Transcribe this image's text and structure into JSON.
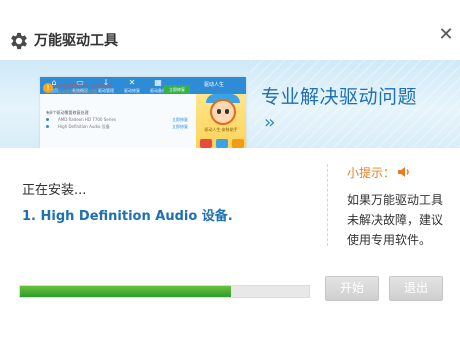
{
  "window": {
    "title": "万能驱动工具",
    "icon": "gear-icon",
    "close_icon": "close-icon"
  },
  "banner": {
    "headline": "专业解决驱动问题",
    "chevrons": "››",
    "preview": {
      "nav": [
        {
          "label": "首页",
          "icon": "home-icon"
        },
        {
          "label": "系统概况",
          "icon": "monitor-icon"
        },
        {
          "label": "驱动管理",
          "icon": "download-icon"
        },
        {
          "label": "驱动修复",
          "icon": "wrench-icon"
        },
        {
          "label": "驱动备份",
          "icon": "grid-icon"
        }
      ],
      "brand": "驱动人生",
      "alert_text": "2个驱动需要处理，请立即处理。",
      "alert_sub": "·驱动程序更新解决问题",
      "fix_button": "立即修复",
      "section": "有8个驱动需要修复处理",
      "rows": [
        {
          "name": "AMD Radeon HD 7700 Series",
          "status": "立即修复"
        },
        {
          "name": "High Definition Audio 设备",
          "status": "立即修复"
        }
      ],
      "caption": "驱动人生·安装助手"
    }
  },
  "install": {
    "status": "正在安装...",
    "item": "1. High Definition Audio 设备."
  },
  "tip": {
    "title": "小提示：",
    "icon": "speaker-icon",
    "text": "如果万能驱动工具未解决故障，建议使用专用软件。"
  },
  "progress": {
    "percent": 73
  },
  "buttons": {
    "start": "开始",
    "exit": "退出"
  },
  "colors": {
    "accent": "#1f6fb3",
    "tip": "#e67e22",
    "progress": "#2e9b2e",
    "button_disabled": "#cfcfcf"
  }
}
